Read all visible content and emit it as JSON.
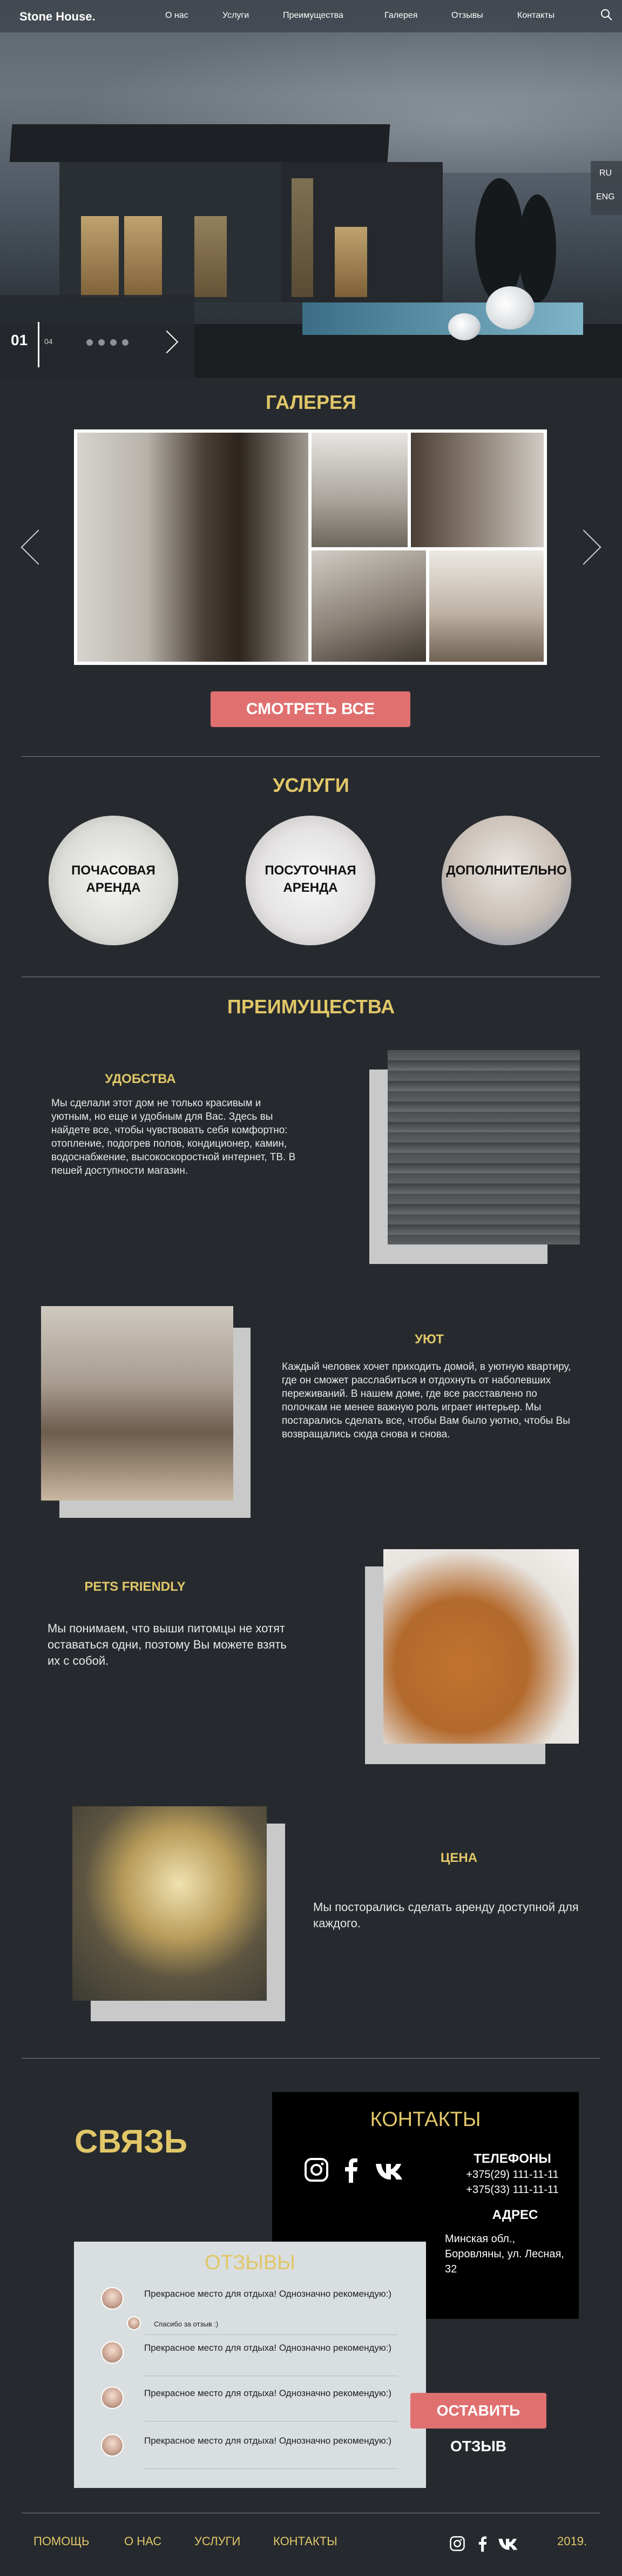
{
  "header": {
    "logo": "Stone House.",
    "menu": [
      "О нас",
      "Услуги",
      "Преимущества",
      "Галерея",
      "Отзывы",
      "Контакты"
    ],
    "languages": [
      "RU",
      "ENG"
    ]
  },
  "hero": {
    "slide_current": "01",
    "slide_total": "04"
  },
  "gallery": {
    "title": "ГАЛЕРЕЯ",
    "button": "СМОТРЕТЬ ВСЕ"
  },
  "services": {
    "title": "УСЛУГИ",
    "items": [
      {
        "label": "ПОЧАСОВАЯ АРЕНДА"
      },
      {
        "label": "ПОСУТОЧНАЯ АРЕНДА"
      },
      {
        "label": "ДОПОЛНИТЕЛЬНО"
      }
    ]
  },
  "advantages": {
    "title": "ПРЕИМУЩЕСТВА",
    "items": [
      {
        "heading": "УДОБСТВА",
        "text": "Мы сделали этот дом не только красивым и уютным, но еще и удобным для Вас. Здесь вы найдете все, чтобы чувствовать себя комфортно: отопление, подогрев полов, кондиционер, камин, водоснабжение, высокоскоростной интернет, ТВ. В пешей доступности магазин."
      },
      {
        "heading": "УЮТ",
        "text": "Каждый человек хочет приходить домой, в уютную квартиру, где он сможет расслабиться и отдохнуть от наболевших переживаний. В нашем доме, где все расставлено по полочкам не менее важную роль играет интерьер. Мы постарались сделать все, чтобы Вам было уютно, чтобы Вы возвращались сюда снова и снова."
      },
      {
        "heading": "PETS FRIENDLY",
        "text": "Мы понимаем, что выши питомцы не хотят оставаться одни, поэтому Вы можете взять их с собой."
      },
      {
        "heading": "ЦЕНА",
        "text": "Мы посторались сделать аренду доступной для каждого."
      }
    ]
  },
  "contact": {
    "heading": "СВЯЗЬ",
    "box_title": "КОНТАКТЫ",
    "phones_title": "ТЕЛЕФОНЫ",
    "phones": [
      "+375(29) 111-11-11",
      "+375(33) 111-11-11"
    ],
    "address_title": "АДРЕС",
    "address": "Минская обл., Боровляны, ул. Лесная, 32"
  },
  "reviews": {
    "title": "ОТЗЫВЫ",
    "items": [
      {
        "text": "Прекрасное место для отдыха! Однозначно рекомендую:)",
        "reply": "Спасибо за отзыв :)"
      },
      {
        "text": "Прекрасное место для отдыха! Однозначно рекомендую:)"
      },
      {
        "text": "Прекрасное место для отдыха! Однозначно рекомендую:)"
      },
      {
        "text": "Прекрасное место для отдыха! Однозначно рекомендую:)"
      }
    ],
    "button": "ОСТАВИТЬ ОТЗЫВ"
  },
  "footer": {
    "links": [
      "ПОМОЩЬ",
      "О НАС",
      "УСЛУГИ",
      "КОНТАКТЫ"
    ],
    "year": "2019."
  },
  "colors": {
    "accent": "#e1c768",
    "button": "#e07070",
    "background": "#262a2f"
  }
}
